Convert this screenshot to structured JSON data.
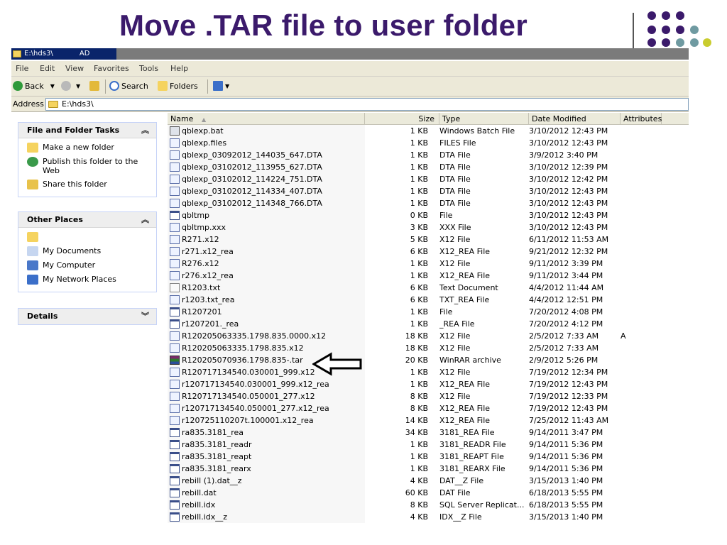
{
  "slide": {
    "title": "Move .TAR file to user folder",
    "dot_colors": {
      "purple": "#3b1a6b",
      "teal": "#6f9aa1",
      "yellow": "#c9cc2e"
    }
  },
  "window": {
    "title": "E:\\hds3\\",
    "title_suffix": "AD",
    "menu": [
      "File",
      "Edit",
      "View",
      "Favorites",
      "Tools",
      "Help"
    ],
    "toolbar": {
      "back": "Back",
      "search": "Search",
      "folders": "Folders"
    },
    "address": {
      "label": "Address",
      "value": "E:\\hds3\\"
    }
  },
  "left_pane": {
    "file_tasks": {
      "header": "File and Folder Tasks",
      "collapse_icon": "chevron-up",
      "items": [
        "Make a new folder",
        "Publish this folder to the Web",
        "Share this folder"
      ]
    },
    "other_places": {
      "header": "Other Places",
      "collapse_icon": "chevron-up",
      "items": [
        "",
        "My Documents",
        "My Computer",
        "My Network Places"
      ]
    },
    "details": {
      "header": "Details",
      "collapse_icon": "chevron-down"
    }
  },
  "columns": [
    "Name",
    "Size",
    "Type",
    "Date Modified",
    "Attributes"
  ],
  "files": [
    {
      "name": "qblexp.bat",
      "size": "1 KB",
      "type": "Windows Batch File",
      "date": "3/10/2012 12:43 PM",
      "attr": "",
      "icon": "batch-file-icon"
    },
    {
      "name": "qblexp.files",
      "size": "1 KB",
      "type": "FILES File",
      "date": "3/10/2012 12:43 PM",
      "attr": "",
      "icon": "generic-file-icon"
    },
    {
      "name": "qblexp_03092012_144035_647.DTA",
      "size": "1 KB",
      "type": "DTA File",
      "date": "3/9/2012 3:40 PM",
      "attr": "",
      "icon": "generic-file-icon"
    },
    {
      "name": "qblexp_03102012_113955_627.DTA",
      "size": "1 KB",
      "type": "DTA File",
      "date": "3/10/2012 12:39 PM",
      "attr": "",
      "icon": "generic-file-icon"
    },
    {
      "name": "qblexp_03102012_114224_751.DTA",
      "size": "1 KB",
      "type": "DTA File",
      "date": "3/10/2012 12:42 PM",
      "attr": "",
      "icon": "generic-file-icon"
    },
    {
      "name": "qblexp_03102012_114334_407.DTA",
      "size": "1 KB",
      "type": "DTA File",
      "date": "3/10/2012 12:43 PM",
      "attr": "",
      "icon": "generic-file-icon"
    },
    {
      "name": "qblexp_03102012_114348_766.DTA",
      "size": "1 KB",
      "type": "DTA File",
      "date": "3/10/2012 12:43 PM",
      "attr": "",
      "icon": "generic-file-icon"
    },
    {
      "name": "qbltmp",
      "size": "0 KB",
      "type": "File",
      "date": "3/10/2012 12:43 PM",
      "attr": "",
      "icon": "table-file-icon"
    },
    {
      "name": "qbltmp.xxx",
      "size": "3 KB",
      "type": "XXX File",
      "date": "3/10/2012 12:43 PM",
      "attr": "",
      "icon": "generic-file-icon"
    },
    {
      "name": "R271.x12",
      "size": "5 KB",
      "type": "X12 File",
      "date": "6/11/2012 11:53 AM",
      "attr": "",
      "icon": "generic-file-icon"
    },
    {
      "name": "r271.x12_rea",
      "size": "6 KB",
      "type": "X12_REA File",
      "date": "9/21/2012 12:32 PM",
      "attr": "",
      "icon": "generic-file-icon"
    },
    {
      "name": "R276.x12",
      "size": "1 KB",
      "type": "X12 File",
      "date": "9/11/2012 3:39 PM",
      "attr": "",
      "icon": "generic-file-icon"
    },
    {
      "name": "r276.x12_rea",
      "size": "1 KB",
      "type": "X12_REA File",
      "date": "9/11/2012 3:44 PM",
      "attr": "",
      "icon": "generic-file-icon"
    },
    {
      "name": "R1203.txt",
      "size": "6 KB",
      "type": "Text Document",
      "date": "4/4/2012 11:44 AM",
      "attr": "",
      "icon": "text-file-icon"
    },
    {
      "name": "r1203.txt_rea",
      "size": "6 KB",
      "type": "TXT_REA File",
      "date": "4/4/2012 12:51 PM",
      "attr": "",
      "icon": "generic-file-icon"
    },
    {
      "name": "R1207201",
      "size": "1 KB",
      "type": "File",
      "date": "7/20/2012 4:08 PM",
      "attr": "",
      "icon": "table-file-icon"
    },
    {
      "name": "r1207201._rea",
      "size": "1 KB",
      "type": "_REA File",
      "date": "7/20/2012 4:12 PM",
      "attr": "",
      "icon": "table-file-icon"
    },
    {
      "name": "R120205063335.1798.835.0000.x12",
      "size": "18 KB",
      "type": "X12 File",
      "date": "2/5/2012 7:33 AM",
      "attr": "A",
      "icon": "generic-file-icon"
    },
    {
      "name": "R120205063335.1798.835.x12",
      "size": "18 KB",
      "type": "X12 File",
      "date": "2/5/2012 7:33 AM",
      "attr": "",
      "icon": "generic-file-icon"
    },
    {
      "name": "R120205070936.1798.835-.tar",
      "size": "20 KB",
      "type": "WinRAR archive",
      "date": "2/9/2012 5:26 PM",
      "attr": "",
      "icon": "winrar-archive-icon"
    },
    {
      "name": "R120717134540.030001_999.x12",
      "size": "1 KB",
      "type": "X12 File",
      "date": "7/19/2012 12:34 PM",
      "attr": "",
      "icon": "generic-file-icon"
    },
    {
      "name": "r120717134540.030001_999.x12_rea",
      "size": "1 KB",
      "type": "X12_REA File",
      "date": "7/19/2012 12:43 PM",
      "attr": "",
      "icon": "generic-file-icon"
    },
    {
      "name": "R120717134540.050001_277.x12",
      "size": "8 KB",
      "type": "X12 File",
      "date": "7/19/2012 12:33 PM",
      "attr": "",
      "icon": "generic-file-icon"
    },
    {
      "name": "r120717134540.050001_277.x12_rea",
      "size": "8 KB",
      "type": "X12_REA File",
      "date": "7/19/2012 12:43 PM",
      "attr": "",
      "icon": "generic-file-icon"
    },
    {
      "name": "r120725110207t.100001.x12_rea",
      "size": "14 KB",
      "type": "X12_REA File",
      "date": "7/25/2012 11:43 AM",
      "attr": "",
      "icon": "generic-file-icon"
    },
    {
      "name": "ra835.3181_rea",
      "size": "34 KB",
      "type": "3181_REA File",
      "date": "9/14/2011 3:47 PM",
      "attr": "",
      "icon": "table-file-icon"
    },
    {
      "name": "ra835.3181_readr",
      "size": "1 KB",
      "type": "3181_READR File",
      "date": "9/14/2011 5:36 PM",
      "attr": "",
      "icon": "table-file-icon"
    },
    {
      "name": "ra835.3181_reapt",
      "size": "1 KB",
      "type": "3181_REAPT File",
      "date": "9/14/2011 5:36 PM",
      "attr": "",
      "icon": "table-file-icon"
    },
    {
      "name": "ra835.3181_rearx",
      "size": "1 KB",
      "type": "3181_REARX File",
      "date": "9/14/2011 5:36 PM",
      "attr": "",
      "icon": "table-file-icon"
    },
    {
      "name": "rebill (1).dat__z",
      "size": "4 KB",
      "type": "DAT__Z File",
      "date": "3/15/2013 1:40 PM",
      "attr": "",
      "icon": "table-file-icon"
    },
    {
      "name": "rebill.dat",
      "size": "60 KB",
      "type": "DAT File",
      "date": "6/18/2013 5:55 PM",
      "attr": "",
      "icon": "table-file-icon"
    },
    {
      "name": "rebill.idx",
      "size": "8 KB",
      "type": "SQL Server Replicat...",
      "date": "6/18/2013 5:55 PM",
      "attr": "",
      "icon": "table-file-icon"
    },
    {
      "name": "rebill.idx__z",
      "size": "4 KB",
      "type": "IDX__Z File",
      "date": "3/15/2013 1:40 PM",
      "attr": "",
      "icon": "table-file-icon"
    }
  ],
  "highlighted_file_index": 19
}
